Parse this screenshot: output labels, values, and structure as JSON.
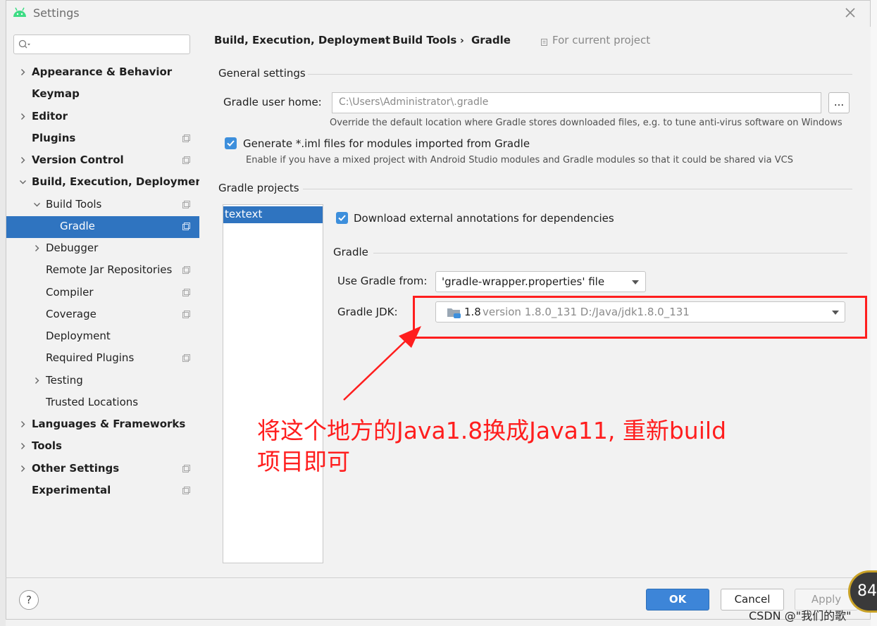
{
  "window": {
    "title": "Settings"
  },
  "sidebar": {
    "items": [
      {
        "label": "Appearance & Behavior",
        "bold": true,
        "arrow": "right",
        "copy": false
      },
      {
        "label": "Keymap",
        "bold": true,
        "arrow": "",
        "copy": false
      },
      {
        "label": "Editor",
        "bold": true,
        "arrow": "right",
        "copy": false
      },
      {
        "label": "Plugins",
        "bold": true,
        "arrow": "",
        "copy": true
      },
      {
        "label": "Version Control",
        "bold": true,
        "arrow": "right",
        "copy": true
      },
      {
        "label": "Build, Execution, Deployment",
        "bold": true,
        "arrow": "down",
        "copy": false
      },
      {
        "label": "Build Tools",
        "bold": false,
        "arrow": "down",
        "copy": true
      },
      {
        "label": "Gradle",
        "bold": false,
        "arrow": "",
        "copy": true,
        "selected": true
      },
      {
        "label": "Debugger",
        "bold": false,
        "arrow": "right",
        "copy": false
      },
      {
        "label": "Remote Jar Repositories",
        "bold": false,
        "arrow": "",
        "copy": true
      },
      {
        "label": "Compiler",
        "bold": false,
        "arrow": "",
        "copy": true
      },
      {
        "label": "Coverage",
        "bold": false,
        "arrow": "",
        "copy": true
      },
      {
        "label": "Deployment",
        "bold": false,
        "arrow": "",
        "copy": false
      },
      {
        "label": "Required Plugins",
        "bold": false,
        "arrow": "",
        "copy": true
      },
      {
        "label": "Testing",
        "bold": false,
        "arrow": "right",
        "copy": false
      },
      {
        "label": "Trusted Locations",
        "bold": false,
        "arrow": "",
        "copy": false
      },
      {
        "label": "Languages & Frameworks",
        "bold": true,
        "arrow": "right",
        "copy": false
      },
      {
        "label": "Tools",
        "bold": true,
        "arrow": "right",
        "copy": false
      },
      {
        "label": "Other Settings",
        "bold": true,
        "arrow": "right",
        "copy": true
      },
      {
        "label": "Experimental",
        "bold": true,
        "arrow": "",
        "copy": true
      }
    ]
  },
  "breadcrumb": {
    "items": [
      "Build, Execution, Deployment",
      "Build Tools",
      "Gradle"
    ],
    "scope": "For current project"
  },
  "general": {
    "title": "General settings",
    "user_home_label": "Gradle user home:",
    "user_home_value": "C:\\Users\\Administrator\\.gradle",
    "browse_label": "...",
    "user_home_hint": "Override the default location where Gradle stores downloaded files, e.g. to tune anti-virus software on Windows",
    "iml_label": "Generate *.iml files for modules imported from Gradle",
    "iml_hint": "Enable if you have a mixed project with Android Studio modules and Gradle modules so that it could be shared via VCS"
  },
  "projects": {
    "title": "Gradle projects",
    "list": [
      "textext"
    ],
    "download_label": "Download external annotations for dependencies",
    "gradle_title": "Gradle",
    "use_from_label": "Use Gradle from:",
    "use_from_value": "'gradle-wrapper.properties' file",
    "jdk_label": "Gradle JDK:",
    "jdk_version": "1.8",
    "jdk_detail": "version 1.8.0_131 D:/Java/jdk1.8.0_131"
  },
  "annotation": {
    "line1": "将这个地方的Java1.8换成Java11, 重新build",
    "line2": "项目即可",
    "color": "#ff1e1e"
  },
  "footer": {
    "help": "?",
    "ok": "OK",
    "cancel": "Cancel",
    "apply": "Apply"
  },
  "watermark": "CSDN @\"我们的歌\"",
  "badge": "84",
  "colors": {
    "accent": "#2f74c0",
    "checkbox": "#3d8fdc",
    "ok_button": "#3d85d8"
  }
}
